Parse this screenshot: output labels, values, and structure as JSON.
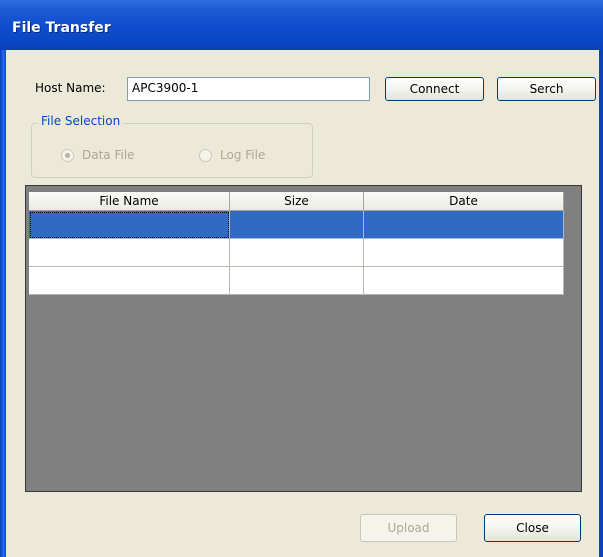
{
  "window": {
    "title": "File Transfer"
  },
  "host": {
    "label": "Host Name:",
    "value": "APC3900-1",
    "connect_label": "Connect",
    "search_label": "Serch"
  },
  "file_selection": {
    "legend": "File Selection",
    "options": [
      {
        "label": "Data File",
        "selected": true,
        "enabled": false
      },
      {
        "label": "Log File",
        "selected": false,
        "enabled": false
      }
    ]
  },
  "table": {
    "columns": [
      "File Name",
      "Size",
      "Date"
    ],
    "rows": [
      {
        "file_name": "",
        "size": "",
        "date": "",
        "selected": true
      },
      {
        "file_name": "",
        "size": "",
        "date": "",
        "selected": false
      },
      {
        "file_name": "",
        "size": "",
        "date": "",
        "selected": false
      }
    ]
  },
  "footer": {
    "upload_label": "Upload",
    "upload_enabled": false,
    "close_label": "Close"
  },
  "colors": {
    "titlebar": "#0a46c2",
    "selection": "#316ac5",
    "grid_background": "#808080",
    "group_legend": "#0046d5"
  }
}
